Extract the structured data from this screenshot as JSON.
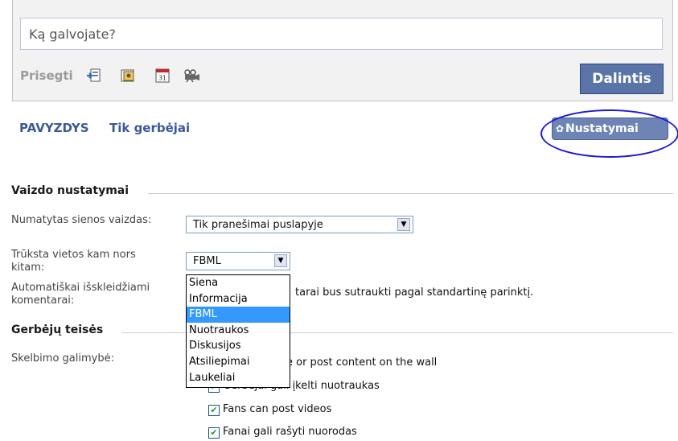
{
  "composer": {
    "placeholder": "Ką galvojate?",
    "attach_label": "Prisegti",
    "attachments": [
      {
        "icon": "link-attach-icon"
      },
      {
        "icon": "photo-attach-icon"
      },
      {
        "icon": "event-attach-icon",
        "text": "31"
      },
      {
        "icon": "video-attach-icon"
      }
    ],
    "share_label": "Dalintis"
  },
  "tabs": [
    {
      "label": "PAVYZDYS"
    },
    {
      "label": "Tik gerbėjai"
    }
  ],
  "settings_button": {
    "label": "Nustatymai",
    "icon": "gear-icon"
  },
  "view_settings": {
    "title": "Vaizdo nustatymai",
    "default_view_label": "Numatytas sienos vaizdas:",
    "default_view_value": "Tik pranešimai puslapyje",
    "missing_space_label_line1": "Trūksta vietos kam nors",
    "missing_space_label_line2": "kitam:",
    "missing_space_value": "FBML",
    "auto_expand_label_line1": "Automatiškai išskleidžiami",
    "auto_expand_label_line2": "komentarai:",
    "auto_expand_text_visible": "tarai bus sutraukti pagal standartinę parinktį."
  },
  "dropdown": {
    "options": [
      "Siena",
      "Informacija",
      "FBML",
      "Nuotraukos",
      "Diskusijos",
      "Atsiliepimai",
      "Laukeliai"
    ],
    "selected": "FBML"
  },
  "fan_permissions": {
    "title": "Gerbėjų teisės",
    "posting_label": "Skelbimo galimybė:",
    "option1_visible": "e or post content on the wall",
    "option2_visible": "Gerbėjai gali įkelti nuotraukas",
    "option3": "Fans can post videos",
    "option4": "Fanai gali rašyti nuorodas"
  }
}
